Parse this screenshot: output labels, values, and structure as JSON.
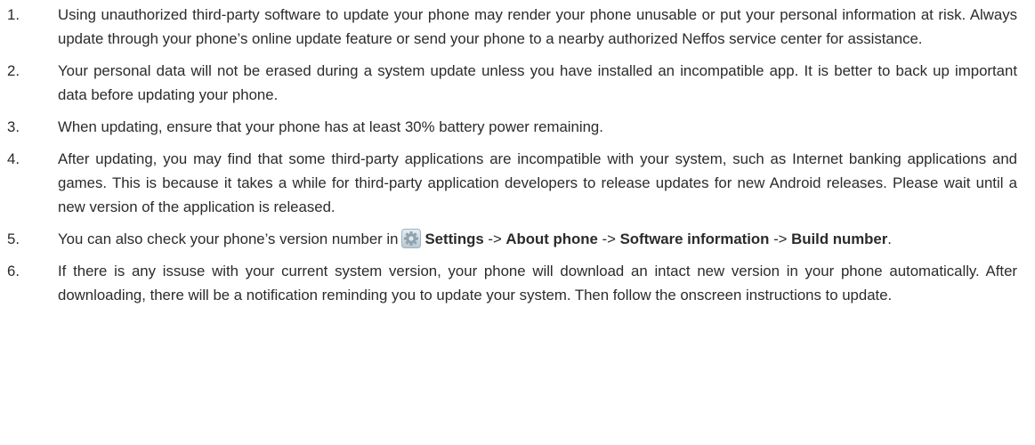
{
  "items": [
    {
      "number": "1.",
      "text": "Using unauthorized third-party software to update your phone may render your phone unusable or put your personal information at risk. Always update through your phone’s online update feature or send your phone to a nearby authorized Neffos service center for assistance."
    },
    {
      "number": "2.",
      "text": "Your personal data will not be erased during a system update unless you have installed an incompatible app. It is better to back up important data before updating your phone."
    },
    {
      "number": "3.",
      "text": "When updating, ensure that your phone has at least 30% battery power remaining."
    },
    {
      "number": "4.",
      "text": "After updating, you may find that some third-party applications are incompatible with your system, such as Internet banking applications and games. This is because it takes a while for third-party application developers to release updates for new Android releases. Please wait until a new version of the application is released."
    },
    {
      "number": "5.",
      "text_before": "You can also check your phone’s version number in",
      "icon": "gear-icon",
      "settings": "Settings",
      "arrow1": " -> ",
      "about_phone": "About phone",
      "arrow2": " -> ",
      "software_information": "Software information",
      "arrow3": " -> ",
      "build_number": "Build number",
      "end": "."
    },
    {
      "number": "6.",
      "text": "If there is any issuse with your current system version, your phone will download an intact new version in your phone automatically. After downloading, there will be a notification reminding you to update your system. Then follow the onscreen instructions to update."
    }
  ]
}
